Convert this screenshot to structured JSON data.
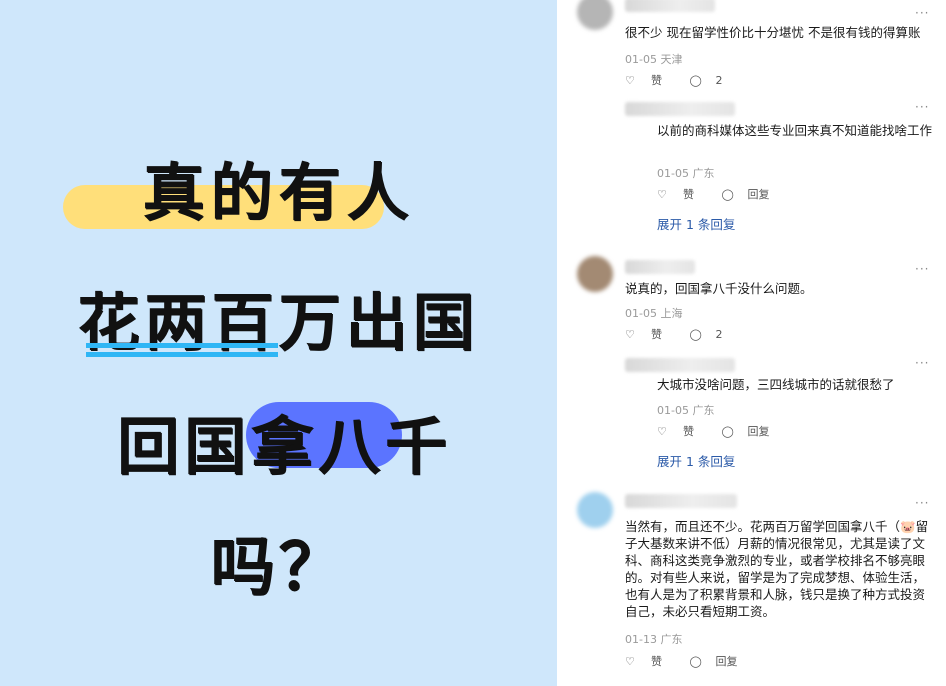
{
  "poster": {
    "line1": "真的有人",
    "line2": "花两百万出国",
    "line3": "回国拿八千",
    "line4": "吗？"
  },
  "comments": [
    {
      "text": "很不少 现在留学性价比十分堪忧 不是很有钱的得算账",
      "date_location": "01-05 天津",
      "like_label": "赞",
      "reply_count": "2",
      "more": "···",
      "avatar_color": "#b9b9b9",
      "replies": [
        {
          "text": "以前的商科媒体这些专业回来真不知道能找啥工作",
          "date_location": "01-05 广东",
          "like_label": "赞",
          "reply_label": "回复",
          "more": "···"
        }
      ],
      "expand_label": "展开 1 条回复"
    },
    {
      "text": "说真的，回国拿八千没什么问题。",
      "date_location": "01-05 上海",
      "like_label": "赞",
      "reply_count": "2",
      "more": "···",
      "avatar_color": "#a38a73",
      "replies": [
        {
          "text": "大城市没啥问题，三四线城市的话就很愁了",
          "date_location": "01-05 广东",
          "like_label": "赞",
          "reply_label": "回复",
          "more": "···"
        }
      ],
      "expand_label": "展开 1 条回复"
    },
    {
      "text": "当然有，而且还不少。花两百万留学回国拿八千（🐷留子大基数来讲不低）月薪的情况很常见，尤其是读了文科、商科这类竞争激烈的专业，或者学校排名不够亮眼的。对有些人来说，留学是为了完成梦想、体验生活，也有人是为了积累背景和人脉，钱只是换了种方式投资自己，未必只看短期工资。",
      "date_location": "01-13 广东",
      "like_label": "赞",
      "reply_label": "回复",
      "more": "···",
      "avatar_color": "#9fd0ee"
    }
  ],
  "icons": {
    "like": "heart-outline-icon",
    "comment": "speech-bubble-icon",
    "more": "more-dots-icon"
  }
}
